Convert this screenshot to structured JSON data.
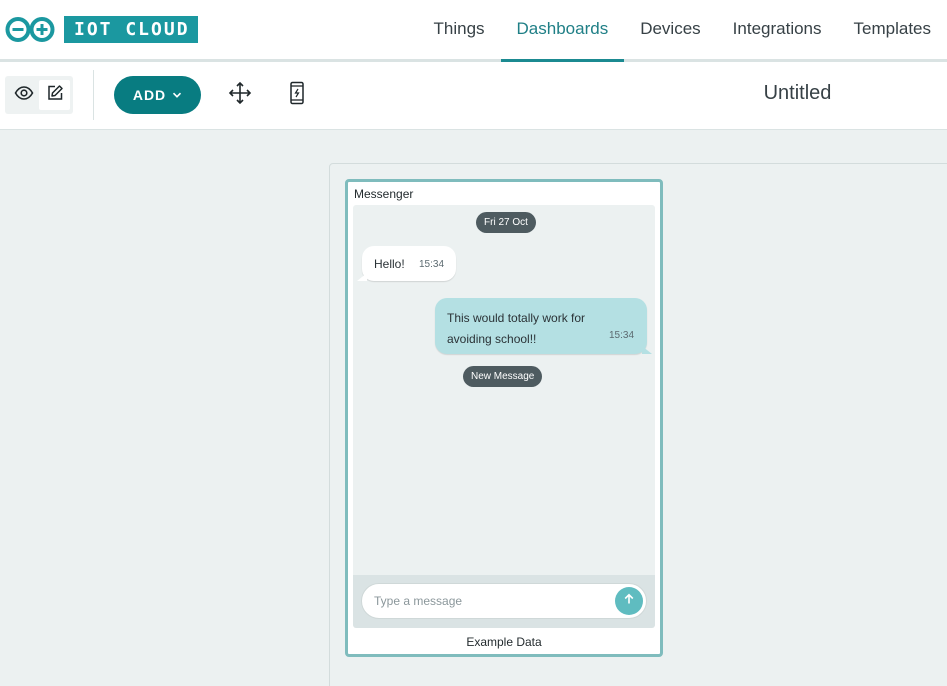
{
  "brand": {
    "logo_text": "IOT CLOUD"
  },
  "nav": {
    "items": [
      {
        "label": "Things"
      },
      {
        "label": "Dashboards"
      },
      {
        "label": "Devices"
      },
      {
        "label": "Integrations"
      },
      {
        "label": "Templates"
      }
    ],
    "active": "Dashboards"
  },
  "toolbar": {
    "add_label": "ADD",
    "dashboard_title": "Untitled",
    "icons": [
      "eye-icon",
      "pencil-icon",
      "chevron-down-icon",
      "move-arrows-icon",
      "mobile-phone-icon"
    ]
  },
  "widget": {
    "title": "Messenger",
    "date_pill": "Fri 27 Oct",
    "messages": [
      {
        "direction": "incoming",
        "text": "Hello!",
        "time": "15:34"
      },
      {
        "direction": "outgoing",
        "text": "This would totally work for avoiding school!!",
        "time": "15:34"
      }
    ],
    "new_message_pill": "New Message",
    "input_placeholder": "Type a message",
    "footer": "Example Data"
  },
  "colors": {
    "brand_teal": "#1b98a0",
    "add_button": "#087c81",
    "widget_border": "#7fbcbd",
    "outgoing_bubble": "#b4e0e3",
    "send_button": "#5fbcc0",
    "pill_bg": "#4e5b60"
  }
}
